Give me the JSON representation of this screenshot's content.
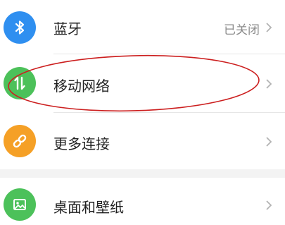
{
  "settings": {
    "items": [
      {
        "id": "bluetooth",
        "label": "蓝牙",
        "value": "已关闭",
        "icon": "bluetooth-icon",
        "icon_color": "#2f8ff0"
      },
      {
        "id": "mobile-network",
        "label": "移动网络",
        "value": "",
        "icon": "mobile-data-arrows-icon",
        "icon_color": "#4cc15a"
      },
      {
        "id": "more-connections",
        "label": "更多连接",
        "value": "",
        "icon": "link-icon",
        "icon_color": "#f5a026"
      },
      {
        "id": "desktop-wallpaper",
        "label": "桌面和壁纸",
        "value": "",
        "icon": "image-icon",
        "icon_color": "#4cc15a"
      }
    ]
  },
  "colors": {
    "background": "#ffffff",
    "section_gap": "#f3f3f3",
    "divider": "#e6e6e6",
    "text_primary": "#1f1f1f",
    "text_secondary": "#8a8a8a",
    "annotation": "#cc1f1f"
  }
}
